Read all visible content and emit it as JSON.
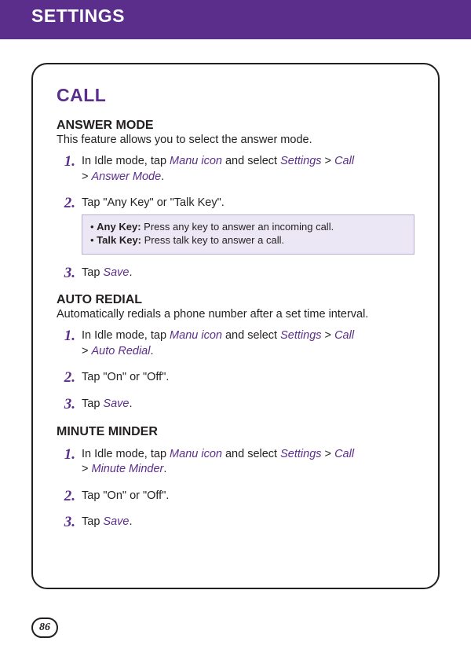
{
  "colors": {
    "purple": "#5b2e8c",
    "noteBg": "#ece7f4",
    "noteBorder": "#b8aed1",
    "text": "#231f20"
  },
  "header": {
    "title": "SETTINGS"
  },
  "pageNumber": "86",
  "section": {
    "title": "CALL"
  },
  "answerMode": {
    "heading": "ANSWER MODE",
    "intro": "This feature allows you to select the answer mode.",
    "steps": {
      "n1": "1.",
      "n2": "2.",
      "n3": "3.",
      "s1_a": "In Idle mode, tap ",
      "s1_manuIcon": "Manu icon",
      "s1_b": " and select ",
      "s1_settings": "Settings",
      "s1_gt1": " > ",
      "s1_call": "Call",
      "s1_gt2": " > ",
      "s1_answerMode": "Answer Mode",
      "s1_dot": ".",
      "s2": "Tap \"Any Key\" or \"Talk Key\".",
      "s3_a": "Tap ",
      "s3_save": "Save",
      "s3_dot": "."
    },
    "note": {
      "bullet": "• ",
      "anyKeyLabel": "Any Key:",
      "anyKeyText": " Press any key to answer an incoming call.",
      "talkKeyLabel": "Talk Key:",
      "talkKeyText": " Press talk key to answer a call."
    }
  },
  "autoRedial": {
    "heading": "AUTO REDIAL",
    "intro": "Automatically redials a phone number after a set time interval.",
    "steps": {
      "n1": "1.",
      "n2": "2.",
      "n3": "3.",
      "s1_a": "In Idle mode, tap ",
      "s1_manuIcon": "Manu icon",
      "s1_b": " and select ",
      "s1_settings": "Settings",
      "s1_gt1": " > ",
      "s1_call": "Call",
      "s1_gt2": " > ",
      "s1_autoRedial": "Auto Redial",
      "s1_dot": ".",
      "s2": "Tap \"On\" or \"Off\".",
      "s3_a": "Tap ",
      "s3_save": "Save",
      "s3_dot": "."
    }
  },
  "minuteMinder": {
    "heading": "MINUTE MINDER",
    "steps": {
      "n1": "1.",
      "n2": "2.",
      "n3": "3.",
      "s1_a": "In Idle mode, tap ",
      "s1_manuIcon": "Manu icon",
      "s1_b": " and select ",
      "s1_settings": "Settings",
      "s1_gt1": " > ",
      "s1_call": "Call",
      "s1_gt2": " > ",
      "s1_minuteMinder": "Minute Minder",
      "s1_dot": ".",
      "s2": "Tap \"On\" or \"Off\".",
      "s3_a": "Tap ",
      "s3_save": "Save",
      "s3_dot": "."
    }
  }
}
